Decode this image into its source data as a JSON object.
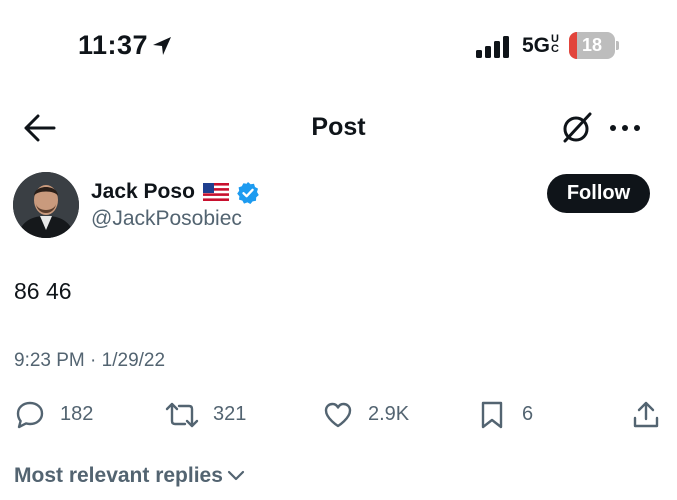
{
  "status_bar": {
    "time": "11:37",
    "network": "5G",
    "network_suffix": "UC",
    "battery_level": "18",
    "battery_fraction": 0.18,
    "battery_color": "#e2453c"
  },
  "header": {
    "title": "Post",
    "icons": [
      "back-arrow-icon",
      "grok-icon",
      "more-icon"
    ]
  },
  "post": {
    "author": {
      "display_name": "Jack Poso",
      "flag": "🇺🇸",
      "handle": "@JackPosobiec",
      "verified": true
    },
    "follow_label": "Follow",
    "text": "86 46",
    "time": "9:23 PM",
    "separator": "·",
    "date": "1/29/22",
    "stats": {
      "replies": "182",
      "reposts": "321",
      "likes": "2.9K",
      "bookmarks": "6"
    }
  },
  "replies_sort_label": "Most relevant replies",
  "colors": {
    "text_primary": "#0f1419",
    "text_secondary": "#536471",
    "verified_blue": "#1d9bf0"
  }
}
